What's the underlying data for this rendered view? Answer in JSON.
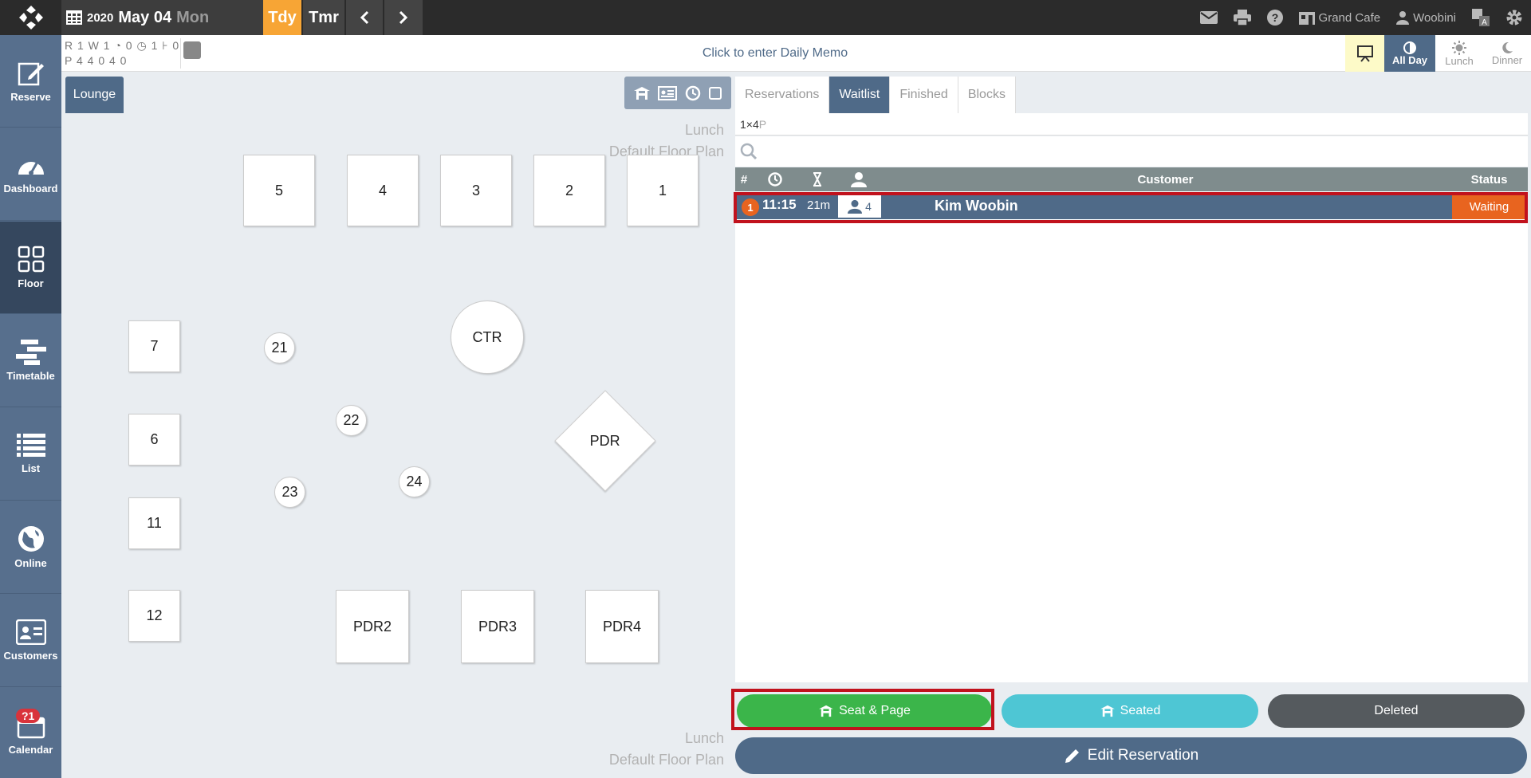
{
  "header": {
    "year": "2020",
    "month_day": "May 04",
    "weekday": "Mon",
    "today_label": "Tdy",
    "tomorrow_label": "Tmr",
    "venue": "Grand Cafe",
    "user": "Woobini"
  },
  "sidebar": {
    "items": [
      {
        "label": "Reserve",
        "icon": "edit-icon"
      },
      {
        "label": "Dashboard",
        "icon": "gauge-icon"
      },
      {
        "label": "Floor",
        "icon": "grid-icon"
      },
      {
        "label": "Timetable",
        "icon": "timetable-icon"
      },
      {
        "label": "List",
        "icon": "list-icon"
      },
      {
        "label": "Online",
        "icon": "globe-icon"
      },
      {
        "label": "Customers",
        "icon": "id-card-icon"
      },
      {
        "label": "Calendar",
        "icon": "calendar-icon"
      }
    ],
    "calendar_badge": "?1"
  },
  "counts": {
    "row1": "R 1 W 1 ◔ 0 ◷ 1 ⊦ 0",
    "row2": "P 4  4  0  4  0"
  },
  "memo": "Click to enter Daily Memo",
  "meals": {
    "all_day": "All Day",
    "lunch": "Lunch",
    "dinner": "Dinner"
  },
  "floor": {
    "tab": "Lounge",
    "service_label": "Lunch",
    "plan_label": "Default Floor Plan",
    "tables": [
      "5",
      "4",
      "3",
      "2",
      "1",
      "7",
      "6",
      "11",
      "12",
      "21",
      "22",
      "23",
      "24",
      "CTR",
      "PDR",
      "PDR2",
      "PDR3",
      "PDR4"
    ]
  },
  "panel": {
    "tabs": [
      "Reservations",
      "Waitlist",
      "Finished",
      "Blocks"
    ],
    "summary": "1×4",
    "summary_unit": "P",
    "search_placeholder": "",
    "columns": {
      "num": "#",
      "customer": "Customer",
      "status": "Status"
    },
    "row": {
      "num": "1",
      "time": "11:15",
      "wait": "21m",
      "party": "4",
      "name": "Kim Woobin",
      "status": "Waiting"
    },
    "buttons": {
      "seat_page": "Seat & Page",
      "seated": "Seated",
      "deleted": "Deleted",
      "edit": "Edit Reservation"
    }
  },
  "colors": {
    "accent": "#4f6a88",
    "orange": "#e8641f",
    "today": "#f7a535",
    "green": "#3bb54a",
    "cyan": "#4ec6d4",
    "gray": "#555a5e"
  }
}
